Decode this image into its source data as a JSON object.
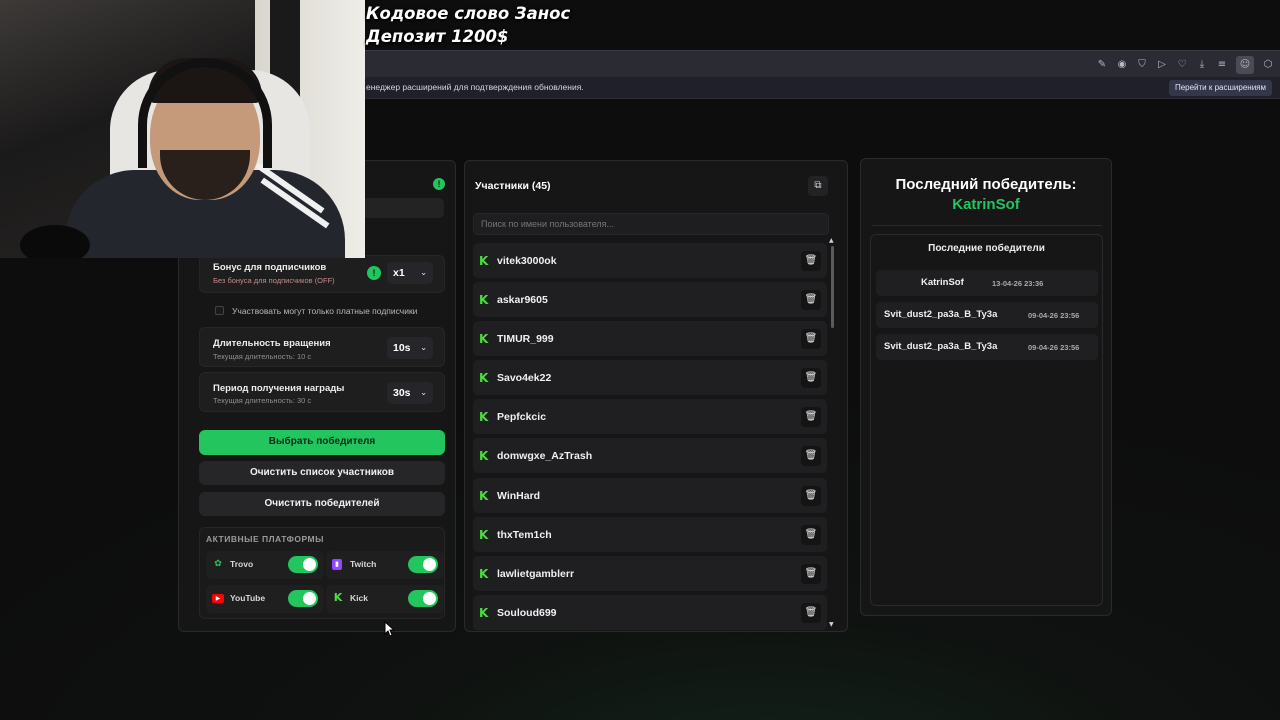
{
  "overlay": {
    "line1": "Кодовое слово Занос",
    "line2": "Депозит 1200$"
  },
  "browser": {
    "notification_text": "енеджер расширений для подтверждения обновления.",
    "notification_button": "Перейти к расширениям",
    "toolbar_icons": [
      "edit-icon",
      "camera-icon",
      "shield-icon",
      "play-icon",
      "heart-icon",
      "download-icon",
      "menu-icon",
      "user-icon",
      "extension-icon"
    ]
  },
  "settings": {
    "subscriber_bonus": {
      "title": "Бонус для подписчиков",
      "subtitle": "Без бонуса для подписчиков (OFF)",
      "value": "x1"
    },
    "paid_only_label": "Участвовать могут только платные подписчики",
    "paid_only_checked": false,
    "spin_duration": {
      "title": "Длительность вращения",
      "subtitle": "Текущая длительность: 10 с",
      "value": "10s"
    },
    "claim_period": {
      "title": "Период получения награды",
      "subtitle": "Текущая длительность: 30 с",
      "value": "30s"
    },
    "pick_winner_label": "Выбрать победителя",
    "clear_participants_label": "Очистить список участников",
    "clear_winners_label": "Очистить победителей",
    "platforms_label": "АКТИВНЫЕ ПЛАТФОРМЫ",
    "platforms": [
      {
        "name": "Trovo",
        "enabled": true,
        "color": "#22c55e"
      },
      {
        "name": "Twitch",
        "enabled": true,
        "color": "#9146ff"
      },
      {
        "name": "YouTube",
        "enabled": true,
        "color": "#ff0000"
      },
      {
        "name": "Kick",
        "enabled": true,
        "color": "#53fc18"
      }
    ]
  },
  "participants": {
    "title": "Участники (45)",
    "search_placeholder": "Поиск по имени пользователя...",
    "list": [
      "vitek3000ok",
      "askar9605",
      "TIMUR_999",
      "Savo4ek22",
      "Pepfckcic",
      "domwgxe_AzTrash",
      "WinHard",
      "thxTem1ch",
      "lawlietgamblerr",
      "Souloud699"
    ]
  },
  "winners": {
    "last_winner_label": "Последний победитель:",
    "last_winner_name": "KatrinSof",
    "recent_title": "Последние победители",
    "recent": [
      {
        "name": "KatrinSof",
        "date": "13-04-26 23:36"
      },
      {
        "name": "Svit_dust2_pa3a_B_Ty3a",
        "date": "09-04-26 23:56"
      },
      {
        "name": "Svit_dust2_pa3a_B_Ty3a",
        "date": "09-04-26 23:56"
      }
    ]
  },
  "colors": {
    "accent": "#22c55e",
    "kick_green": "#4ade3e"
  }
}
